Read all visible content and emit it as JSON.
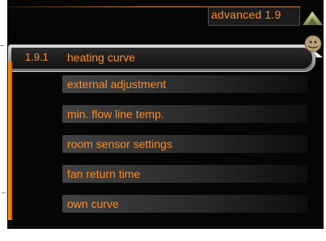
{
  "header": {
    "title": "advanced 1.9",
    "home_icon": "house-icon",
    "help_icon": "help-icon"
  },
  "menu": {
    "selected_number": "1.9.1",
    "items": [
      {
        "label": "heating curve"
      },
      {
        "label": "external adjustment"
      },
      {
        "label": "min. flow line temp."
      },
      {
        "label": "room sensor settings"
      },
      {
        "label": "fan return time"
      },
      {
        "label": "own curve"
      }
    ]
  },
  "scrollbar": {
    "position_fraction": 0.0
  },
  "colors": {
    "accent": "#ff8a20",
    "background": "#050505",
    "row": "#3a3a3a"
  }
}
